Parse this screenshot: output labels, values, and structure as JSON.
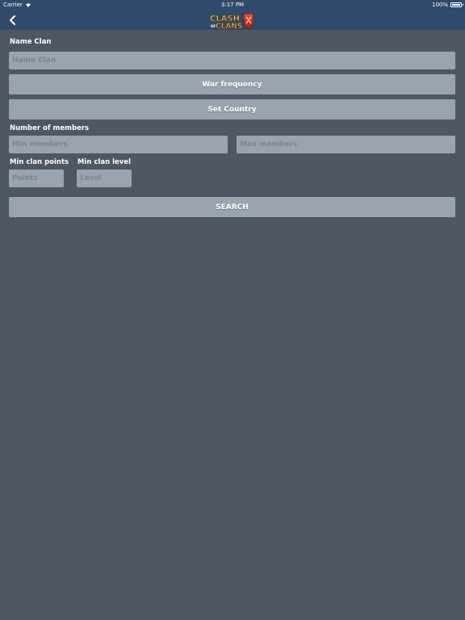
{
  "status_bar": {
    "carrier": "Carrier",
    "time": "3:17 PM",
    "battery": "100%",
    "battery_level": 1.0
  },
  "nav": {
    "logo_line1": "CLASH",
    "logo_line2": "OF",
    "logo_line3": "CLANS"
  },
  "form": {
    "name_clan_label": "Name Clan",
    "name_clan_placeholder": "Name Clan",
    "war_frequency_label": "War frequency",
    "set_country_label": "Set Country",
    "members_label": "Number of members",
    "min_members_placeholder": "Min members",
    "max_members_placeholder": "Max members",
    "min_points_label": "Min clan points",
    "min_level_label": "Min clan level",
    "points_placeholder": "Points",
    "level_placeholder": "Level",
    "search_label": "SEARCH"
  },
  "colors": {
    "background": "#4e5763",
    "header": "#2f4a6a",
    "field": "#9aa4b0",
    "placeholder": "#7c8692",
    "text": "#ffffff"
  },
  "icons": {
    "back": "chevron-left-icon",
    "wifi": "wifi-icon",
    "battery": "battery-icon"
  }
}
